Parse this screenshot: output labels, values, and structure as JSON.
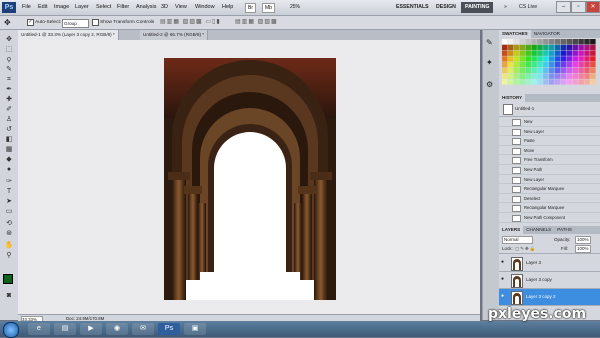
{
  "app": {
    "logo": "Ps"
  },
  "menu": [
    "File",
    "Edit",
    "Image",
    "Layer",
    "Select",
    "Filter",
    "Analysis",
    "3D",
    "View",
    "Window",
    "Help"
  ],
  "topbar": {
    "zoom": "25%",
    "workspaces": [
      "ESSENTIALS",
      "DESIGN",
      "PAINTING"
    ],
    "active_workspace": "PAINTING",
    "cs_live": "CS Live"
  },
  "options": {
    "auto_select": "Auto-Select:",
    "auto_select_value": "Group",
    "show_transform": "Show Transform Controls"
  },
  "tabs": [
    {
      "label": "Untitled-1 @ 33.3% (Layer 3 copy 2, RGB/8) *",
      "active": true
    },
    {
      "label": "Untitled-2 @ 66.7% (RGB/8) *",
      "active": false
    }
  ],
  "status": {
    "zoom": "33.33%",
    "doc": "Doc: 24.9M/170.8M"
  },
  "panels": {
    "swatches_tab": "SWATCHES",
    "navigator_tab": "NAVIGATOR",
    "history_tab": "HISTORY",
    "history_source": "Untitled-1",
    "history": [
      "New",
      "New Layer",
      "Paste",
      "Move",
      "Free Transform",
      "New Path",
      "New Layer",
      "Rectangular Marquee",
      "Deselect",
      "Rectangular Marquee",
      "New Path Component"
    ],
    "layers_tabs": [
      "LAYERS",
      "CHANNELS",
      "PATHS"
    ],
    "blend_mode": "Normal",
    "opacity_label": "Opacity:",
    "opacity": "100%",
    "lock_label": "Lock:",
    "fill_label": "Fill:",
    "fill": "100%",
    "layers": [
      {
        "name": "Layer 3",
        "selected": false
      },
      {
        "name": "Layer 3 copy",
        "selected": false
      },
      {
        "name": "Layer 3 copy 2",
        "selected": true
      }
    ]
  },
  "watermark": "pxleyes.com"
}
